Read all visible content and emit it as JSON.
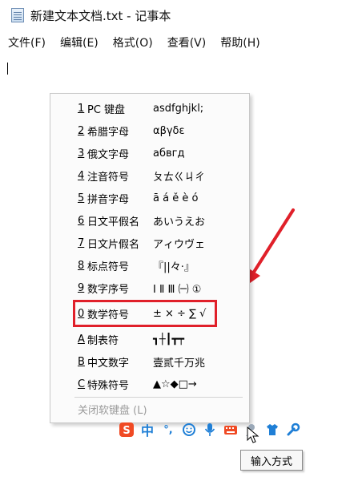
{
  "window": {
    "title": "新建文本文档.txt - 记事本"
  },
  "menubar": {
    "items": [
      "文件(F)",
      "编辑(E)",
      "格式(O)",
      "查看(V)",
      "帮助(H)"
    ]
  },
  "soft_keyboard_menu": {
    "items": [
      {
        "key": "1",
        "label": "PC 键盘",
        "sample": "asdfghjkl;"
      },
      {
        "key": "2",
        "label": "希腊字母",
        "sample": "αβγδε"
      },
      {
        "key": "3",
        "label": "俄文字母",
        "sample": "абвгд"
      },
      {
        "key": "4",
        "label": "注音符号",
        "sample": "ㄆㄊㄍㄐㄔ"
      },
      {
        "key": "5",
        "label": "拼音字母",
        "sample": "ā á ě è ó"
      },
      {
        "key": "6",
        "label": "日文平假名",
        "sample": "あいうえお"
      },
      {
        "key": "7",
        "label": "日文片假名",
        "sample": "アィウヴェ"
      },
      {
        "key": "8",
        "label": "标点符号",
        "sample": "『||々·』"
      },
      {
        "key": "9",
        "label": "数字序号",
        "sample": "Ⅰ Ⅱ Ⅲ ㈠ ①"
      },
      {
        "key": "0",
        "label": "数学符号",
        "sample": "± × ÷ ∑ √"
      },
      {
        "key": "A",
        "label": "制表符",
        "sample": "┓┼┃┳┯"
      },
      {
        "key": "B",
        "label": "中文数字",
        "sample": "壹贰千万兆"
      },
      {
        "key": "C",
        "label": "特殊符号",
        "sample": "▲☆◆□→"
      }
    ],
    "close_label": "关闭软键盘 (L)",
    "highlight_color": "#e0202a"
  },
  "ime_toolbar": {
    "icons": [
      "sogou-logo-icon",
      "chinese-mode-icon",
      "punctuation-icon",
      "emoji-icon",
      "microphone-icon",
      "keyboard-icon",
      "user-icon",
      "skin-icon",
      "tools-icon"
    ],
    "chinese_mode_label": "中",
    "punct_label": "°,"
  },
  "tooltip": {
    "text": "输入方式"
  }
}
